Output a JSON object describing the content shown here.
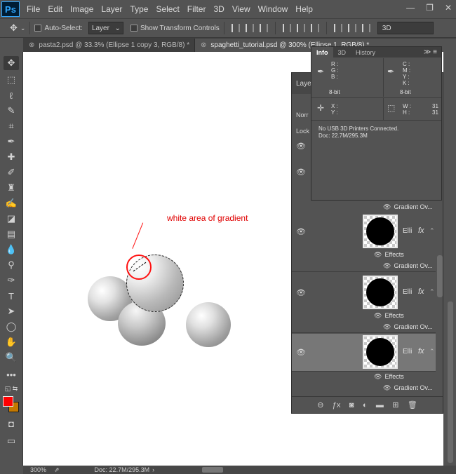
{
  "app": {
    "logo": "Ps"
  },
  "menu": [
    "File",
    "Edit",
    "Image",
    "Layer",
    "Type",
    "Select",
    "Filter",
    "3D",
    "View",
    "Window",
    "Help"
  ],
  "window_controls": {
    "minimize": "—",
    "restore": "❐",
    "close": "✕"
  },
  "options_bar": {
    "auto_select_label": "Auto-Select:",
    "auto_select_value": "Layer",
    "show_transform_label": "Show Transform Controls",
    "mode_3d_label": "3D"
  },
  "tabs": [
    {
      "label": "pasta2.psd @ 33.3% (Ellipse 1 copy 3, RGB/8) *",
      "active": false
    },
    {
      "label": "spaghetti_tutorial.psd @ 300% (Ellipse 1, RGB/8) *",
      "active": true
    }
  ],
  "canvas": {
    "annotation": "white area of gradient"
  },
  "status": {
    "zoom": "300%",
    "doc": "Doc: 22.7M/295.3M"
  },
  "info_panel": {
    "tabs": [
      "Info",
      "3D",
      "History"
    ],
    "rgb_labels": [
      "R :",
      "G :",
      "B :"
    ],
    "cmyk_labels": [
      "C :",
      "M :",
      "Y :",
      "K :"
    ],
    "bit_left": "8-bit",
    "bit_right": "8-bit",
    "xy_labels": [
      "X :",
      "Y :"
    ],
    "wh_labels": [
      "W :",
      "H :"
    ],
    "width_value": "31",
    "height_value": "31",
    "printer_message": "No USB 3D Printers Connected.",
    "doc_info": "Doc: 22.7M/295.3M"
  },
  "layers_panel": {
    "tab_label": "Laye",
    "blend_mode": "Norr",
    "lock_label": "Lock",
    "layers": [
      {
        "name": "Elli",
        "effects": "Effects",
        "gradient": "Gradient Ov...",
        "selected": false
      },
      {
        "name": "Elli",
        "effects": "Effects",
        "gradient": "Gradient Ov...",
        "selected": false
      },
      {
        "name": "Elli",
        "effects": "Effects",
        "gradient": "Gradient Ov...",
        "selected": true
      }
    ],
    "top_gradient": "Gradient Ov..."
  }
}
